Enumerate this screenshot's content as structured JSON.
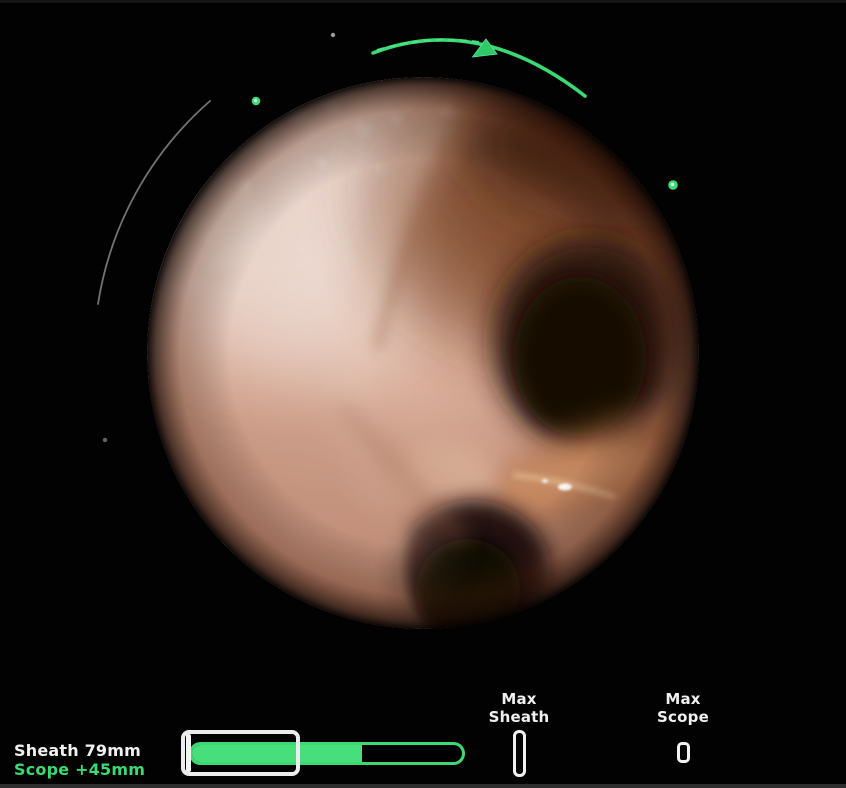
{
  "view": {
    "name": "bronchoscopy-navigation-display",
    "camera_feed": "endoscopic airway view with two bronchial openings"
  },
  "telemetry": {
    "sheath_label": "Sheath 79mm",
    "scope_label": "Scope +45mm",
    "sheath_mm": 79,
    "scope_mm": "+45"
  },
  "progress_bar": {
    "scope_fill_percent": 63
  },
  "markers": {
    "max_sheath": {
      "line1": "Max",
      "line2": "Sheath"
    },
    "max_scope": {
      "line1": "Max",
      "line2": "Scope"
    }
  },
  "overlay_icons": {
    "direction_marker": "triangle-up",
    "heading_arc": "green-arc",
    "range_arc": "gray-arc",
    "waypoint_dots": "green-dots",
    "debris_dots": "gray-dots"
  },
  "colors": {
    "accent_green": "#3cd973",
    "accent_green_bright": "#46df7c",
    "text_white": "#f0f0f0",
    "background": "#020202"
  }
}
